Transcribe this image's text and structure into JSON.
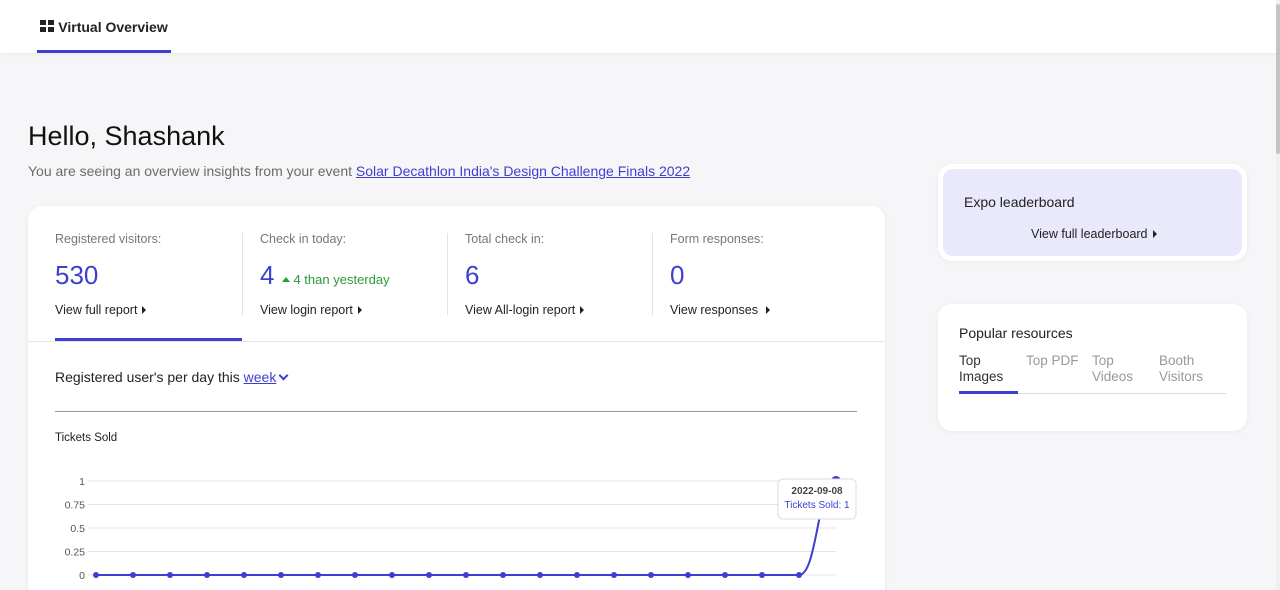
{
  "header": {
    "tab_label": "Virtual Overview"
  },
  "greeting": "Hello, Shashank",
  "subtitle": {
    "text": "You are seeing an overview insights from your event ",
    "event_link": "Solar Decathlon India's Design Challenge Finals 2022"
  },
  "stats": [
    {
      "label": "Registered visitors:",
      "value": "530",
      "link": "View full report"
    },
    {
      "label": "Check in today:",
      "value": "4",
      "delta": "4 than yesterday",
      "link": "View login report"
    },
    {
      "label": "Total check in:",
      "value": "6",
      "link": "View All-login report"
    },
    {
      "label": "Form responses:",
      "value": "0",
      "link": "View responses"
    }
  ],
  "chart_section": {
    "heading": "Registered user's per day this ",
    "period": "week"
  },
  "chart_data": {
    "type": "line",
    "title": "Tickets Sold",
    "y_ticks": [
      "1",
      "0.75",
      "0.5",
      "0.25",
      "0"
    ],
    "ylim": [
      0,
      1
    ],
    "series": [
      {
        "name": "Tickets Sold",
        "values": [
          0,
          0,
          0,
          0,
          0,
          0,
          0,
          0,
          0,
          0,
          0,
          0,
          0,
          0,
          0,
          0,
          0,
          0,
          0,
          0,
          1
        ]
      }
    ],
    "tooltip": {
      "date": "2022-09-08",
      "label": "Tickets Sold",
      "value": "1"
    },
    "colors": {
      "line": "#3d3fd0",
      "grid": "#e4e4e4"
    },
    "grid": true
  },
  "expo": {
    "title": "Expo leaderboard",
    "link": "View full leaderboard"
  },
  "popular": {
    "title": "Popular resources",
    "tabs": [
      {
        "line1": "Top",
        "line2": "Images"
      },
      {
        "line1": "Top PDF",
        "line2": ""
      },
      {
        "line1": "Top",
        "line2": "Videos"
      },
      {
        "line1": "Booth",
        "line2": "Visitors"
      }
    ]
  }
}
